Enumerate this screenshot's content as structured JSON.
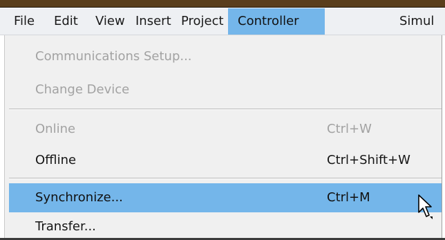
{
  "menubar": {
    "items": [
      {
        "label": "File"
      },
      {
        "label": "Edit"
      },
      {
        "label": "View"
      },
      {
        "label": "Insert"
      },
      {
        "label": "Project"
      },
      {
        "label": "Controller",
        "active": true
      },
      {
        "label": "Simul"
      }
    ]
  },
  "controller_menu": {
    "items": [
      {
        "label": "Communications Setup...",
        "shortcut": "",
        "enabled": false
      },
      {
        "label": "Change Device",
        "shortcut": "",
        "enabled": false
      },
      {
        "label": "Online",
        "shortcut": "Ctrl+W",
        "enabled": false
      },
      {
        "label": "Offline",
        "shortcut": "Ctrl+Shift+W",
        "enabled": true
      },
      {
        "label": "Synchronize...",
        "shortcut": "Ctrl+M",
        "enabled": true,
        "highlighted": true
      },
      {
        "label": "Transfer...",
        "shortcut": "",
        "enabled": true
      }
    ]
  },
  "colors": {
    "highlight": "#74b6ea",
    "menu_background": "#f0f0f0",
    "disabled_text": "#a2a2a2",
    "title_strip": "#5a3e1c"
  },
  "cursor": {
    "icon": "mouse-pointer-icon"
  }
}
